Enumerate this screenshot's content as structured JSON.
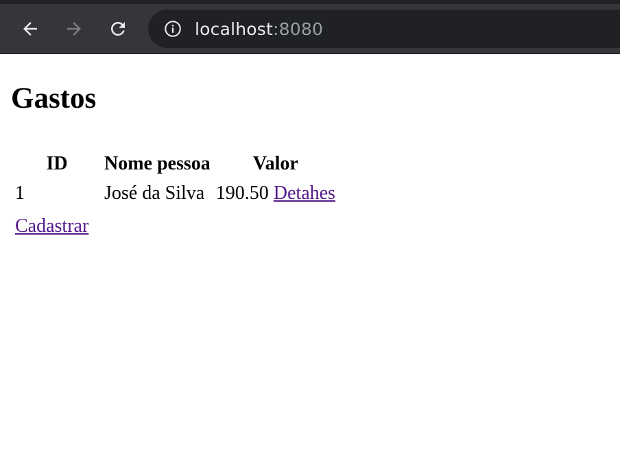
{
  "browser": {
    "url_host": "localhost",
    "url_port": ":8080",
    "icons": [
      "back-arrow-icon",
      "forward-arrow-icon",
      "reload-icon",
      "info-icon"
    ]
  },
  "page": {
    "title": "Gastos",
    "table": {
      "headers": [
        "ID",
        "Nome pessoa",
        "Valor"
      ],
      "rows": [
        {
          "id": "1",
          "nome": "José da Silva",
          "valor": "190.50",
          "link": "Detahes"
        }
      ]
    },
    "cadastrar_link": "Cadastrar"
  }
}
